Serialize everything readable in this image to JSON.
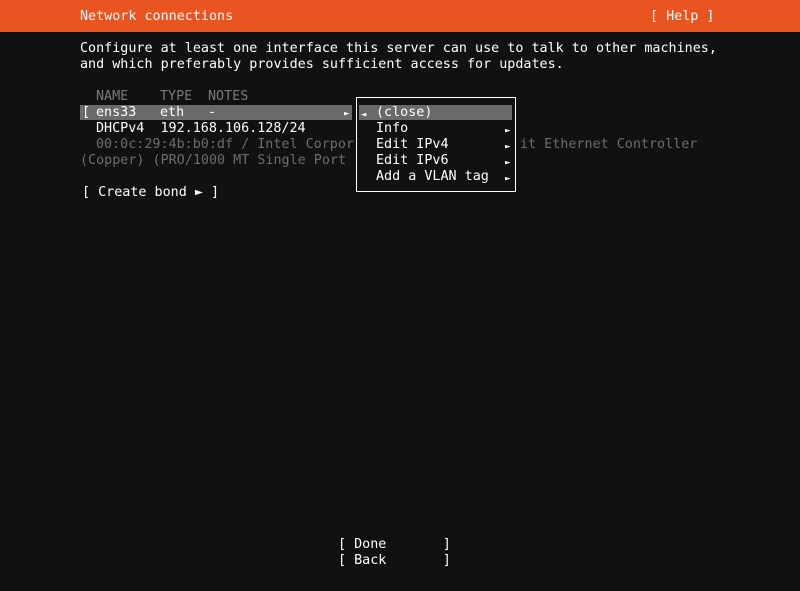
{
  "header": {
    "title": "Network connections",
    "help_label": "[ Help ]"
  },
  "intro": {
    "line1": "Configure at least one interface this server can use to talk to other machines,",
    "line2": "and which preferably provides sufficient access for updates."
  },
  "table": {
    "columns": {
      "name": "NAME",
      "type": "TYPE",
      "notes": "NOTES"
    },
    "interface": {
      "bracket": "[",
      "name": "ens33",
      "type": "eth",
      "notes": "-",
      "expand_arrow": "►"
    },
    "address_line": "DHCPv4  192.168.106.128/24",
    "hw_line1_left": "00:0c:29:4b:b0:df / Intel Corpor",
    "hw_line1_right": "it Ethernet Controller",
    "hw_line2": "(Copper) (PRO/1000 MT Single Port"
  },
  "create_bond_label": "[ Create bond ► ]",
  "context_menu": {
    "close_arrow": "◄",
    "items": [
      {
        "label": "(close)",
        "arrow": ""
      },
      {
        "label": "Info",
        "arrow": "►"
      },
      {
        "label": "Edit IPv4",
        "arrow": "►"
      },
      {
        "label": "Edit IPv6",
        "arrow": "►"
      },
      {
        "label": "Add a VLAN tag",
        "arrow": "►"
      }
    ]
  },
  "footer": {
    "done_label": "[ Done       ]",
    "back_label": "[ Back       ]"
  }
}
